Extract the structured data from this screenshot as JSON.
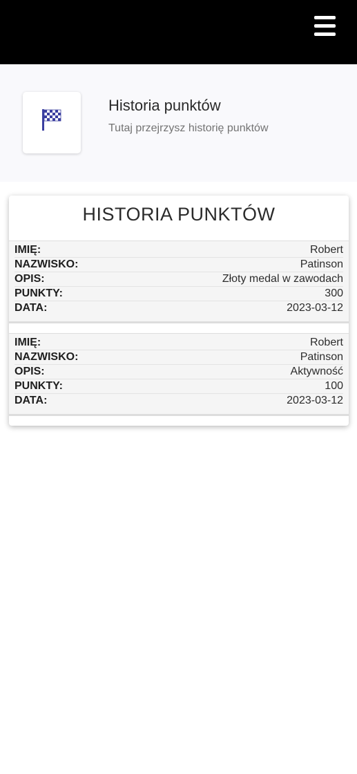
{
  "topbar": {
    "menu_icon": "hamburger-menu-icon"
  },
  "header": {
    "icon": "checkered-flag-icon",
    "icon_color": "#3b3fa0",
    "title": "Historia punktów",
    "subtitle": "Tutaj przejrzysz historię punktów"
  },
  "card": {
    "title": "HISTORIA PUNKTÓW",
    "labels": {
      "first_name": "IMIĘ:",
      "last_name": "NAZWISKO:",
      "description": "OPIS:",
      "points": "PUNKTY:",
      "date": "DATA:"
    },
    "records": [
      {
        "first_name": "Robert",
        "last_name": "Patinson",
        "description": "Złoty medal w zawodach",
        "points": "300",
        "date": "2023-03-12"
      },
      {
        "first_name": "Robert",
        "last_name": "Patinson",
        "description": "Aktywność",
        "points": "100",
        "date": "2023-03-12"
      }
    ]
  }
}
